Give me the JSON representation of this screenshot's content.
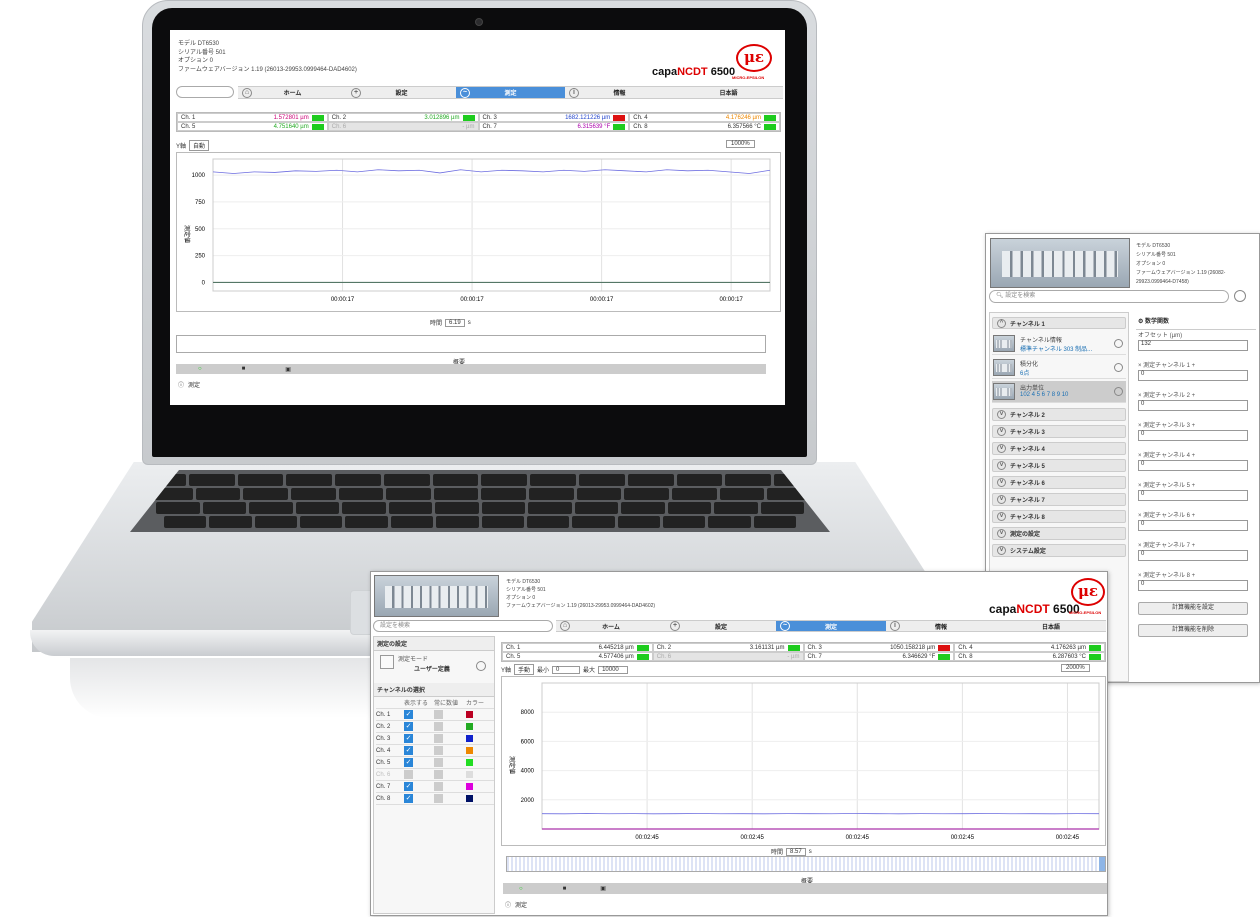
{
  "laptop_app": {
    "info_lines": [
      "モデル DT6530",
      "シリアル番号 501",
      "オプション 0",
      "ファームウェアバージョン 1.19 (26013-29953.0999464-DAD4602)"
    ],
    "brand_prefix": "capa",
    "brand_highlight": "NCDT",
    "brand_suffix": " 6500",
    "logo_text": "μɛ",
    "logo_sub": "MICRO-EPSILON",
    "nav": [
      "ホーム",
      "設定",
      "測定",
      "情報",
      "日本語"
    ],
    "channels": [
      {
        "label": "Ch. 1",
        "value": "1.572801 µm",
        "color": "#cc0077"
      },
      {
        "label": "Ch. 2",
        "value": "3.012896 µm",
        "color": "#22aa22"
      },
      {
        "label": "Ch. 3",
        "value": "1682.121226 µm",
        "color": "#2244cc"
      },
      {
        "label": "Ch. 4",
        "value": "4.176246 µm",
        "color": "#ee8800"
      },
      {
        "label": "Ch. 5",
        "value": "4.751640 µm",
        "color": "#22aa22"
      },
      {
        "label": "Ch. 6",
        "value": "- µm",
        "color": "#aaaaaa"
      },
      {
        "label": "Ch. 7",
        "value": "6.315639 °F",
        "color": "#aa00aa"
      },
      {
        "label": "Ch. 8",
        "value": "6.357566 °C",
        "color": "#333333"
      }
    ],
    "y_axis_select": "Y軸",
    "y_axis_value": "自動",
    "zoom_value": "1000%",
    "ylabel": "測定値",
    "bottom_label": "概要",
    "time_label": "時間",
    "time_value": "6.19",
    "time_unit": "s",
    "status_label": "測定",
    "chart_data": {
      "type": "line",
      "x_ticks": [
        "00:00:17",
        "00:00:17",
        "00:00:17",
        "00:00:17"
      ],
      "y_ticks": [
        "1000",
        "750",
        "500",
        "250",
        "0"
      ],
      "ylim": [
        -80,
        1150
      ],
      "series": [
        {
          "values": [
            1030,
            1015,
            1030,
            1025,
            1040,
            1035,
            1045,
            1030,
            1050,
            1040,
            1045,
            1020,
            1050,
            1030,
            1045,
            1040,
            1030,
            1045,
            1035,
            1050,
            1040,
            1030,
            1050,
            1040,
            1045,
            1030,
            1015,
            1045
          ]
        },
        {
          "values": [
            0,
            0,
            0,
            0,
            0,
            0,
            0,
            0,
            0,
            0,
            0,
            0,
            0,
            0,
            0,
            0,
            0,
            0,
            0,
            0,
            0,
            0,
            0,
            0,
            0,
            0,
            0,
            0
          ]
        }
      ]
    }
  },
  "settings_panel": {
    "info_lines": [
      "モデル DT6530",
      "シリアル番号 501",
      "オプション 0",
      "ファームウェアバージョン 1.19 (26082-29923.0999464-D7458)"
    ],
    "search_placeholder": "設定を検索",
    "channel1_title": "チャンネル 1",
    "sub_items": [
      {
        "title": "チャンネル情報",
        "value": "標準チャンネル 303 制品..."
      },
      {
        "title": "積分化",
        "value": "6点"
      },
      {
        "title": "出力単位",
        "value": "102 4 5 6 7 8 9 10"
      }
    ],
    "channels": [
      "チャンネル 2",
      "チャンネル 3",
      "チャンネル 4",
      "チャンネル 5",
      "チャンネル 6",
      "チャンネル 7",
      "チャンネル 8",
      "測定の設定",
      "システム設定"
    ],
    "right_title": "数学関数",
    "fields": [
      {
        "label": "オフセット (µm)",
        "value": "132"
      },
      {
        "label": "× 測定チャンネル 1 +",
        "value": "0"
      },
      {
        "label": "× 測定チャンネル 2 +",
        "value": "0"
      },
      {
        "label": "× 測定チャンネル 3 +",
        "value": "0"
      },
      {
        "label": "× 測定チャンネル 4 +",
        "value": "0"
      },
      {
        "label": "× 測定チャンネル 5 +",
        "value": "0"
      },
      {
        "label": "× 測定チャンネル 6 +",
        "value": "0"
      },
      {
        "label": "× 測定チャンネル 7 +",
        "value": "0"
      },
      {
        "label": "× 測定チャンネル 8 +",
        "value": "0"
      }
    ],
    "apply_button": "計算機能を設定",
    "remove_button": "計算機能を削除"
  },
  "measure_window": {
    "info_lines": [
      "モデル DT6530",
      "シリアル番号 501",
      "オプション 0",
      "ファームウェアバージョン 1.19 (26013-29953.0999464-DAD4602)"
    ],
    "search_placeholder": "設定を検索",
    "brand_prefix": "capa",
    "brand_highlight": "NCDT",
    "brand_suffix": " 6500",
    "logo_text": "μɛ",
    "logo_sub": "MICRO-EPSILON",
    "nav": [
      "ホーム",
      "設定",
      "測定",
      "情報",
      "日本語"
    ],
    "measure_settings_title": "測定の設定",
    "measure_mode_label": "測定モード",
    "measure_mode_value": "ユーザー定義",
    "channel_select_title": "チャンネルの選択",
    "table_headers": [
      "",
      "表示する",
      "常に数値",
      "カラー"
    ],
    "table_rows": [
      {
        "ch": "Ch. 1",
        "show": true,
        "color": "#bb0022"
      },
      {
        "ch": "Ch. 2",
        "show": true,
        "color": "#22aa22"
      },
      {
        "ch": "Ch. 3",
        "show": true,
        "color": "#1122cc"
      },
      {
        "ch": "Ch. 4",
        "show": true,
        "color": "#ee8800"
      },
      {
        "ch": "Ch. 5",
        "show": true,
        "color": "#22dd22"
      },
      {
        "ch": "Ch. 6",
        "show": false,
        "color": "#dddddd"
      },
      {
        "ch": "Ch. 7",
        "show": true,
        "color": "#dd00dd"
      },
      {
        "ch": "Ch. 8",
        "show": true,
        "color": "#001166"
      }
    ],
    "channels": [
      {
        "label": "Ch. 1",
        "value": "6.445218 µm"
      },
      {
        "label": "Ch. 2",
        "value": "3.161131 µm"
      },
      {
        "label": "Ch. 3",
        "value": "1050.158218 µm"
      },
      {
        "label": "Ch. 4",
        "value": "4.176263 µm"
      },
      {
        "label": "Ch. 5",
        "value": "4.577406 µm"
      },
      {
        "label": "Ch. 6",
        "value": "- µm"
      },
      {
        "label": "Ch. 7",
        "value": "6.346629 °F"
      },
      {
        "label": "Ch. 8",
        "value": "6.287603 °C"
      }
    ],
    "y_axis_select": "Y軸",
    "y_axis_value": "手動",
    "min_label": "最小",
    "min_value": "0",
    "max_label": "最大",
    "max_value": "10000",
    "zoom_value": "2000%",
    "ylabel": "測定値",
    "time_label": "時間",
    "time_value": "8.57",
    "time_unit": "s",
    "bottom_label": "概要",
    "status_label": "測定",
    "chart_data": {
      "type": "line",
      "x_ticks": [
        "00:02:45",
        "00:02:45",
        "00:02:45",
        "00:02:45",
        "00:02:45"
      ],
      "y_ticks": [
        "8000",
        "6000",
        "4000",
        "2000"
      ],
      "ylim": [
        0,
        10000
      ],
      "series": [
        {
          "values": [
            1050,
            1040,
            1060,
            1045,
            1055,
            1040,
            1050,
            1060,
            1045,
            1050,
            1040,
            1055,
            1050,
            1045,
            1060,
            1050,
            1040,
            1055,
            1045,
            1050,
            1060,
            1045,
            1050,
            1040,
            1055,
            1050
          ]
        },
        {
          "values": [
            0,
            0,
            0,
            0,
            0,
            0,
            0,
            0,
            0,
            0,
            0,
            0,
            0,
            0,
            0,
            0,
            0,
            0,
            0,
            0,
            0,
            0,
            0,
            0,
            0,
            0
          ]
        }
      ]
    }
  }
}
